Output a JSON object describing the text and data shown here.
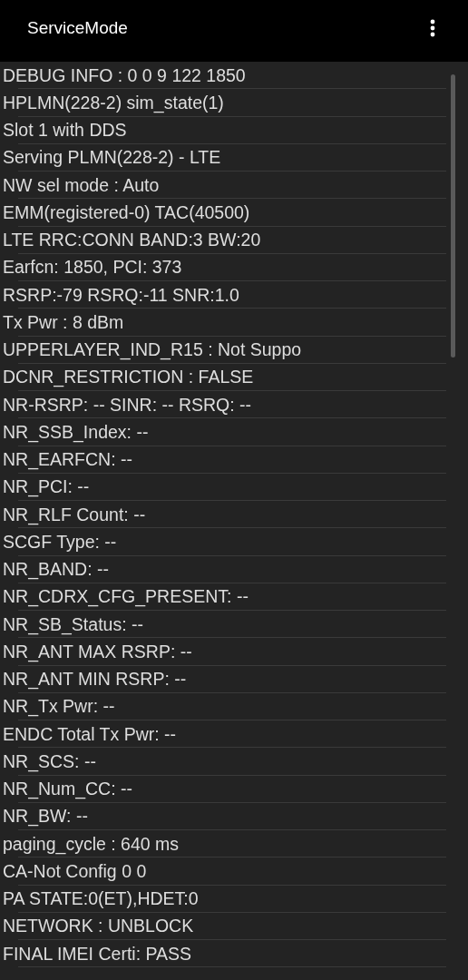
{
  "app_bar": {
    "title": "ServiceMode"
  },
  "info_lines": [
    "DEBUG INFO : 0 0 9 122 1850",
    "HPLMN(228-2) sim_state(1)",
    "Slot 1 with DDS",
    "Serving PLMN(228-2) - LTE",
    "NW sel mode : Auto",
    "EMM(registered-0) TAC(40500)",
    "LTE RRC:CONN BAND:3 BW:20",
    "Earfcn: 1850, PCI: 373",
    "RSRP:-79 RSRQ:-11 SNR:1.0",
    "Tx Pwr : 8 dBm",
    "UPPERLAYER_IND_R15 : Not Suppo",
    "DCNR_RESTRICTION : FALSE",
    "NR-RSRP: -- SINR: -- RSRQ: --",
    "NR_SSB_Index: --",
    "NR_EARFCN: --",
    "NR_PCI: --",
    "NR_RLF Count: --",
    "SCGF Type: --",
    "NR_BAND: --",
    "NR_CDRX_CFG_PRESENT: --",
    "NR_SB_Status: --",
    "NR_ANT MAX RSRP: --",
    "NR_ANT MIN RSRP: --",
    "NR_Tx Pwr: --",
    "ENDC Total Tx Pwr: --",
    "NR_SCS: --",
    "NR_Num_CC: --",
    "NR_BW: --",
    "paging_cycle : 640 ms",
    "CA-Not Config 0 0",
    "PA STATE:0(ET),HDET:0",
    "NETWORK : UNBLOCK",
    "FINAL IMEI Certi: PASS"
  ]
}
